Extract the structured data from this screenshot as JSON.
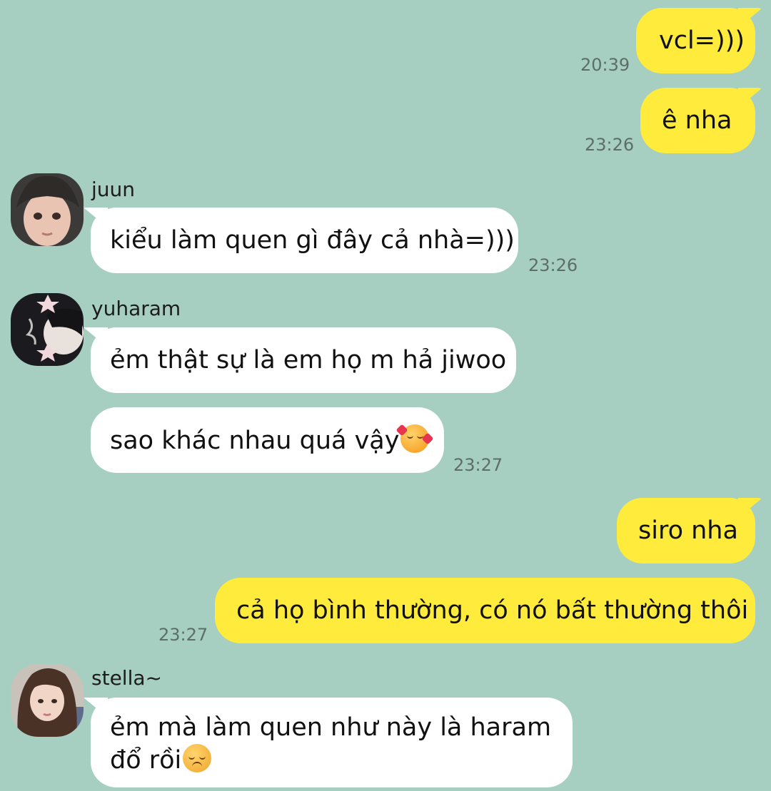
{
  "messages": [
    {
      "id": "m1",
      "text": "vcl=)))",
      "time": "20:39"
    },
    {
      "id": "m2",
      "text": "ê nha",
      "time": "23:26"
    },
    {
      "id": "m3",
      "sender": "juun",
      "text": "kiểu làm quen gì đây cả nhà=)))",
      "time": "23:26"
    },
    {
      "id": "m4",
      "sender": "yuharam",
      "text": "ẻm thật sự là em họ m hả jiwoo"
    },
    {
      "id": "m5",
      "text": "sao khác nhau quá vậy",
      "emoji": "smiling-face-with-hearts-icon",
      "time": "23:27"
    },
    {
      "id": "m6",
      "text": "siro nha"
    },
    {
      "id": "m7",
      "text": "cả họ bình thường, có nó bất thường thôi",
      "time": "23:27"
    },
    {
      "id": "m8",
      "sender": "stella~",
      "text_line1": "ẻm mà làm quen như này là haram",
      "text_line2": "đổ rồi",
      "emoji": "pensive-face-icon"
    }
  ],
  "colors": {
    "background": "#a6cfc2",
    "outgoing_bubble": "#ffeb3b",
    "incoming_bubble": "#ffffff",
    "timestamp": "#5d6e68"
  }
}
